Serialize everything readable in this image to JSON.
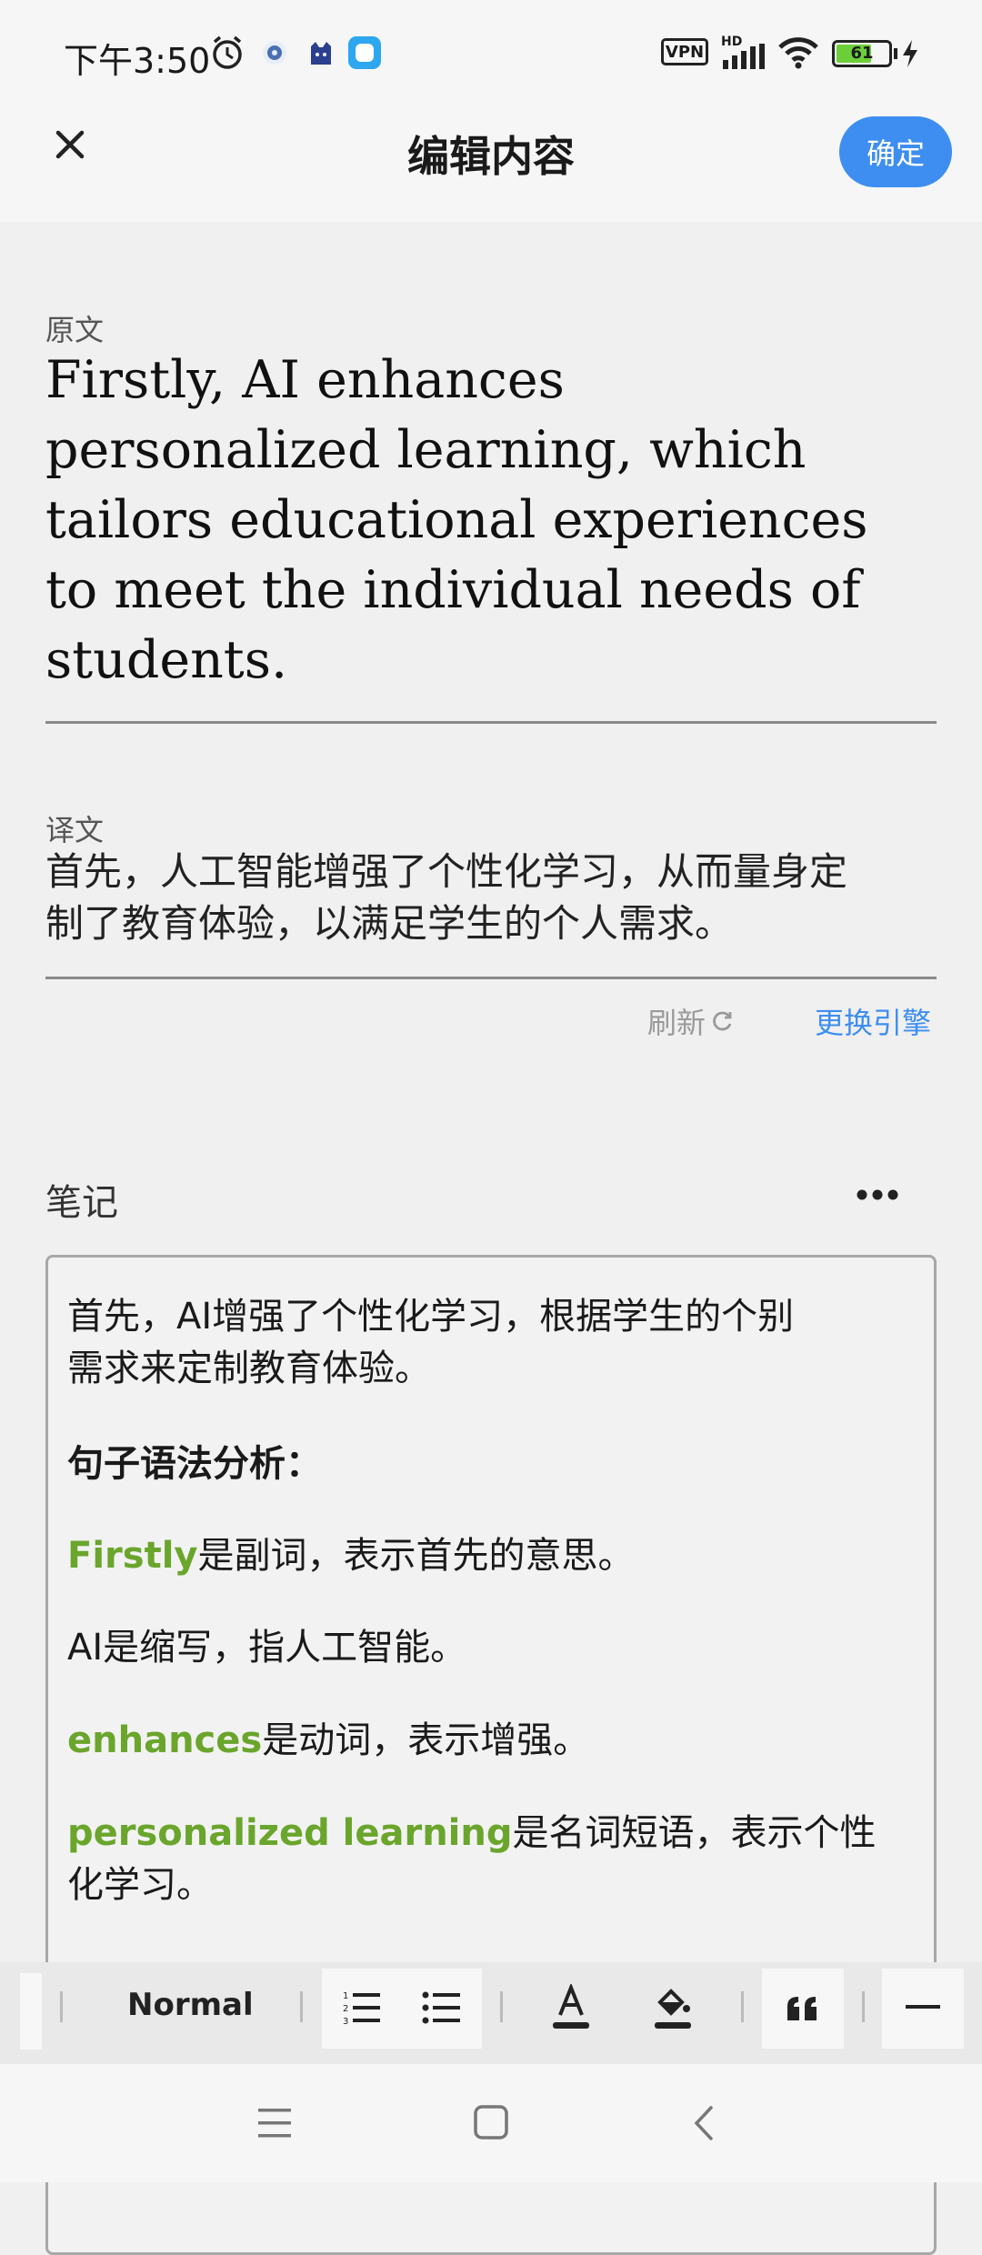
{
  "status_bar": {
    "time": "下午3:50",
    "vpn_label": "VPN",
    "network_label": "HD",
    "battery_level": "61"
  },
  "header": {
    "title": "编辑内容",
    "confirm_label": "确定"
  },
  "source": {
    "label": "原文",
    "lines": [
      "Firstly, AI enhances",
      "personalized learning, which",
      "tailors educational experiences",
      "to meet the individual needs of",
      "students."
    ]
  },
  "translation": {
    "label": "译文",
    "lines": [
      "首先，人工智能增强了个性化学习，从而量身定",
      "制了教育体验，以满足学生的个人需求。"
    ],
    "refresh_label": "刷新",
    "change_engine_label": "更换引擎"
  },
  "notes": {
    "title": "笔记",
    "p1_lines": [
      "首先，AI增强了个性化学习，根据学生的个别",
      "需求来定制教育体验。"
    ],
    "heading": "句子语法分析：",
    "item1_term": "Firstly",
    "item1_rest": "是副词，表示首先的意思。",
    "item2_text": "AI是缩写，指人工智能。",
    "item3_term": "enhances",
    "item3_rest": "是动词，表示增强。",
    "item4_term": "personalized learning",
    "item4_rest": "是名词短语，表示个性",
    "item4_line2": "化学习。"
  },
  "toolbar": {
    "text_style": "Normal"
  },
  "colors": {
    "accent": "#3d8ef0",
    "highlight": "#6aa52c"
  }
}
